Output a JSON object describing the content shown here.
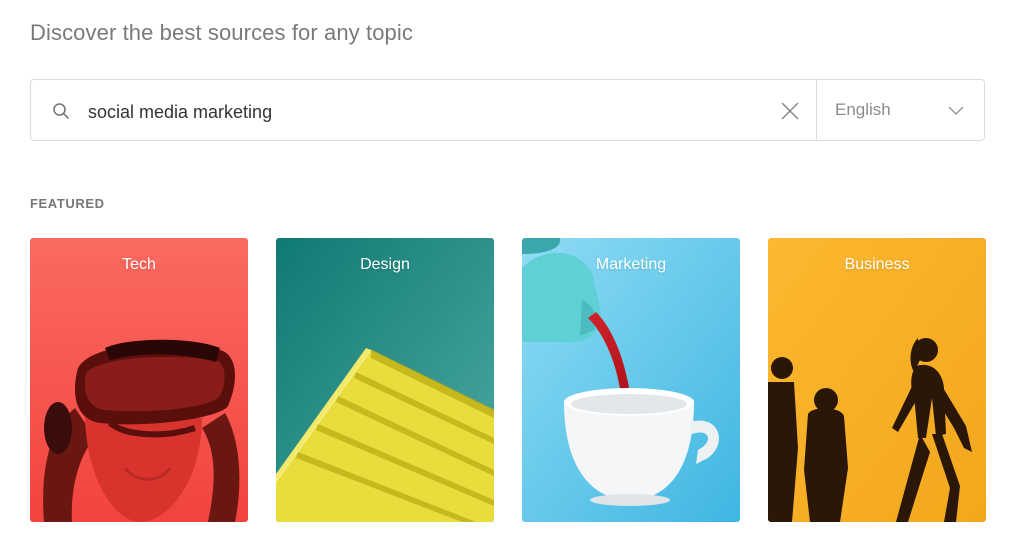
{
  "header": {
    "title": "Discover the best sources for any topic"
  },
  "search": {
    "value": "social media marketing",
    "language": "English"
  },
  "featured": {
    "label": "FEATURED",
    "cards": [
      {
        "label": "Tech",
        "bg": "#f8655f"
      },
      {
        "label": "Design",
        "bg": "#1a8a80"
      },
      {
        "label": "Marketing",
        "bg": "#6bd0f0"
      },
      {
        "label": "Business",
        "bg": "#f9b23a"
      }
    ]
  },
  "icons": {
    "search": "search-icon",
    "clear": "close-icon",
    "dropdown": "chevron-down-icon"
  }
}
